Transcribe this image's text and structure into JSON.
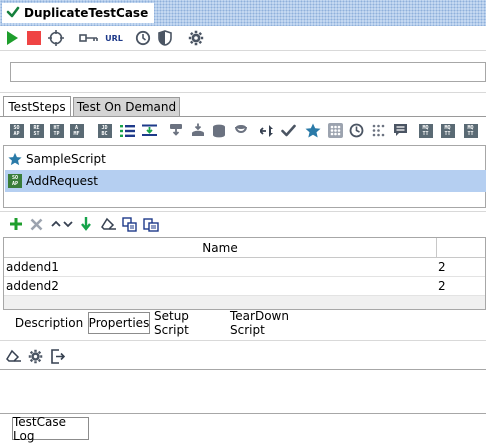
{
  "window": {
    "title": "DuplicateTestCase"
  },
  "toolbar": {
    "url_label": "URL"
  },
  "endpoint": {
    "value": ""
  },
  "tabs": [
    {
      "label": "TestSteps",
      "active": true
    },
    {
      "label": "Test On Demand",
      "active": false
    }
  ],
  "step_toolbar": {
    "icons": [
      "soap-request-icon",
      "rest-request-icon",
      "http-request-icon",
      "amf-request-icon",
      "jdbc-request-icon",
      "groovy-list-icon",
      "property-transfer-icon",
      "datasource-icon",
      "datasink-icon",
      "data-gen-icon",
      "loop-icon",
      "goto-icon",
      "assertion-icon",
      "star-icon",
      "grid-icon",
      "delay-icon",
      "manual-icon",
      "comment-icon",
      "mock-response-icon",
      "mq-icon",
      "mq-drag-icon"
    ],
    "labels": {
      "soap": [
        "SO",
        "AP"
      ],
      "rest": [
        "RE",
        "ST"
      ],
      "http": [
        "HT",
        "TP"
      ],
      "amf": [
        "A",
        "MF"
      ],
      "jdbc": [
        "JD",
        "BC"
      ],
      "mq1": [
        "MQ",
        "TT"
      ],
      "mq2": [
        "MQ",
        "TT"
      ],
      "mq3": [
        "MQ",
        "TT"
      ]
    }
  },
  "steps": [
    {
      "label": "SampleScript",
      "icon": "star-icon",
      "selected": false
    },
    {
      "label": "AddRequest",
      "icon": "soap-icon",
      "selected": true,
      "icon_text": [
        "SO",
        "AP"
      ]
    }
  ],
  "properties": {
    "header": "Name",
    "rows": [
      {
        "name": "addend1",
        "value": "2"
      },
      {
        "name": "addend2",
        "value": "2"
      }
    ]
  },
  "bottom_tabs": [
    {
      "label": "Description",
      "active": false
    },
    {
      "label": "Properties",
      "active": true
    },
    {
      "label": "Setup Script",
      "active": false
    },
    {
      "label": "TearDown Script",
      "active": false
    }
  ],
  "log_button": "TestCase Log",
  "colors": {
    "selection": "#b5cff1",
    "accent_green": "#1e9e2c",
    "stop_red": "#ef4444",
    "title_bg": "#c9dcf3"
  }
}
